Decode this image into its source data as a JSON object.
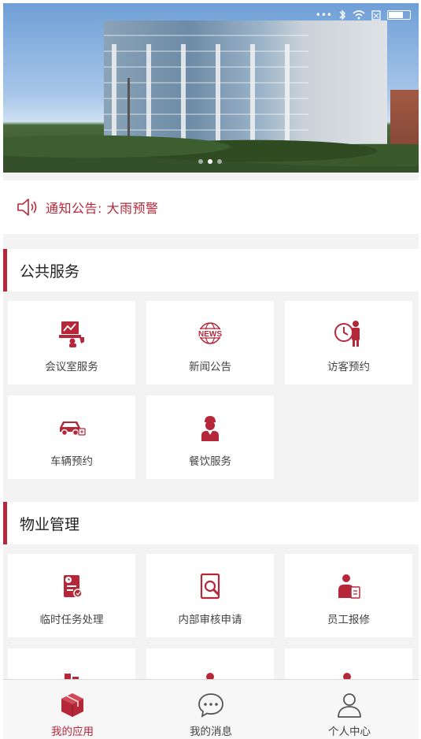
{
  "accent": "#b5283a",
  "status_bar": {
    "dots": "•••",
    "icons": [
      "bluetooth-icon",
      "wifi-icon",
      "sim-icon",
      "battery-icon"
    ]
  },
  "banner": {
    "slides": 3,
    "active_slide": 1
  },
  "notice": {
    "text": "通知公告: 大雨预警",
    "icon": "speaker-icon"
  },
  "sections": [
    {
      "title": "公共服务",
      "items": [
        {
          "label": "会议室服务",
          "icon": "meeting-room-icon"
        },
        {
          "label": "新闻公告",
          "icon": "news-icon"
        },
        {
          "label": "访客预约",
          "icon": "visitor-icon"
        },
        {
          "label": "车辆预约",
          "icon": "car-icon"
        },
        {
          "label": "餐饮服务",
          "icon": "chef-icon"
        }
      ]
    },
    {
      "title": "物业管理",
      "items": [
        {
          "label": "临时任务处理",
          "icon": "task-icon"
        },
        {
          "label": "内部审核申请",
          "icon": "audit-icon"
        },
        {
          "label": "员工报修",
          "icon": "repair-icon"
        }
      ]
    }
  ],
  "tabs": [
    {
      "label": "我的应用",
      "icon": "box-icon",
      "active": true
    },
    {
      "label": "我的消息",
      "icon": "chat-icon",
      "active": false
    },
    {
      "label": "个人中心",
      "icon": "person-icon",
      "active": false
    }
  ],
  "news_icon_text": "NEWS"
}
